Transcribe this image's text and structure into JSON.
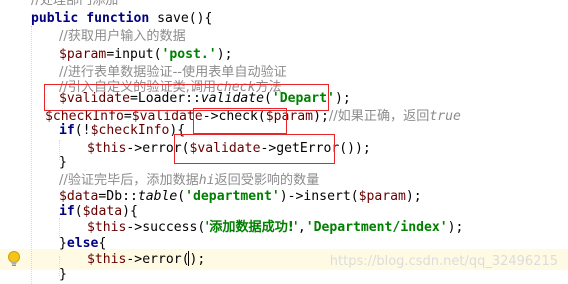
{
  "code": {
    "l1": "//处理部门添加",
    "l2": {
      "k1": "public",
      "k2": "function",
      "rest": "save(){"
    },
    "l3": "//获取用户输入的数据",
    "l4": {
      "v": "$param",
      "a": "=input(",
      "s": "'post.'",
      "b": ");"
    },
    "l5": "//进行表单数据验证--使用表单自动验证",
    "l6": {
      "pre": "//引入自定义的验证类,调用",
      "it": "check",
      "post": "方法"
    },
    "l7": {
      "v": "$validate",
      "a": "=Loader::",
      "m": "validate",
      "b": "(",
      "s": "'Depart'",
      "c": ");"
    },
    "l8": {
      "v1": "$checkInfo",
      "a": "=",
      "v2": "$validate",
      "b": "->check(",
      "v3": "$param",
      "c": ");",
      "cm": "//如果正确，返回",
      "cmit": "true"
    },
    "l9": {
      "k": "if",
      "a": "(!",
      "v": "$checkInfo",
      "b": "){"
    },
    "l10": {
      "v1": "$this",
      "a": "->error(",
      "v2": "$validate",
      "b": "->getError());"
    },
    "l11": "}",
    "l12": {
      "pre": "//验证完毕后，添加数据",
      "it": "hi",
      "post": "返回受影响的数量"
    },
    "l13": {
      "v1": "$data",
      "a": "=Db::",
      "m": "table",
      "b": "(",
      "s": "'department'",
      "c": ")->insert(",
      "v2": "$param",
      "d": ");"
    },
    "l14": {
      "k": "if",
      "a": "(",
      "v": "$data",
      "b": "){"
    },
    "l15": {
      "v": "$this",
      "a": "->success(",
      "s1": "'添加数据成功!'",
      "b": ",",
      "s2": "'Department/index'",
      "c": ");"
    },
    "l16": {
      "a": "}",
      "k": "else",
      "b": "{"
    },
    "l17": {
      "v": "$this",
      "a": "->error();"
    },
    "l18": "}"
  },
  "watermark": "https://blog.csdn.net/qq_32496215",
  "colors": {
    "keyword": "#000080",
    "variable": "#660000",
    "string": "#008000",
    "comment": "#8c8c8c",
    "highlight_box": "#e8262a",
    "current_line": "#fffae3"
  },
  "icons": [
    "lightbulb-icon"
  ]
}
